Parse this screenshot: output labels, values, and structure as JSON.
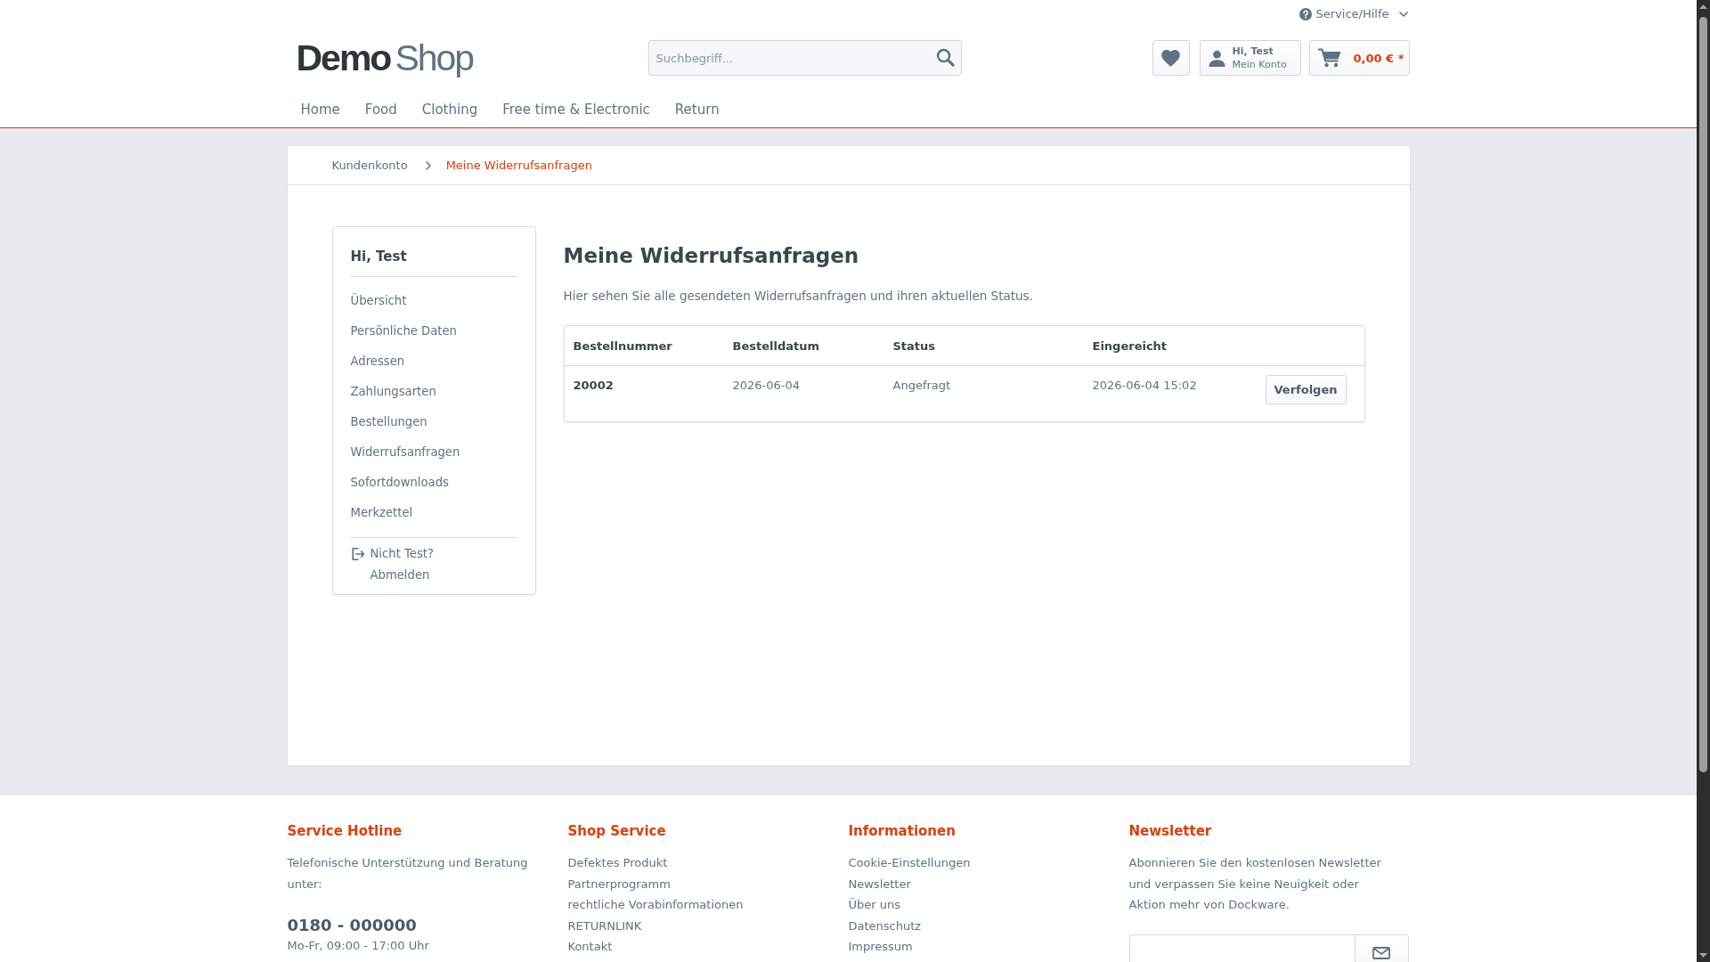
{
  "top_bar": {
    "service_menu": "Service/Hilfe"
  },
  "header": {
    "logo": "**Demo**Shop",
    "search": {
      "placeholder": "Suchbegriff..."
    },
    "account": {
      "greeting": "Hi, Test",
      "label": "Mein Konto"
    },
    "cart": {
      "total": "0,00 € *"
    }
  },
  "navigation": [
    "Home",
    "Food",
    "Clothing",
    "Free time & Electronic",
    "Return"
  ],
  "breadcrumb": [
    {
      "label": "Kundenkonto",
      "current": false
    },
    {
      "label": "Meine Widerrufsanfragen",
      "current": true
    }
  ],
  "sidebar": {
    "greeting": "Hi, Test",
    "items": [
      "Übersicht",
      "Persönliche Daten",
      "Adressen",
      "Zahlungsarten",
      "Bestellungen",
      "Widerrufsanfragen",
      "Sofortdownloads",
      "Merkzettel"
    ],
    "logout": {
      "question": "Nicht Test?",
      "label": "Abmelden"
    }
  },
  "content": {
    "title": "Meine Widerrufsanfragen",
    "description": "Hier sehen Sie alle gesendeten Widerrufsanfragen und ihren aktuellen Status.",
    "table": {
      "columns": [
        "Bestellnummer",
        "Bestelldatum",
        "Status",
        "Eingereicht"
      ],
      "rows": [
        {
          "cells": [
            "20002",
            "2026-06-04",
            "Angefragt",
            "2026-06-04 15:02"
          ],
          "action": "Verfolgen"
        }
      ]
    }
  },
  "footer": {
    "columns": [
      {
        "kind": "hotline",
        "title": "Service Hotline",
        "text": "Telefonische Unterstützung und Beratung unter:",
        "phone": "0180 - 000000",
        "hours": "Mo-Fr, 09:00 - 17:00 Uhr"
      },
      {
        "kind": "links",
        "title": "Shop Service",
        "links": [
          "Defektes Produkt",
          "Partnerprogramm",
          "rechtliche Vorabinformationen",
          "RETURNLINK",
          "Kontakt"
        ]
      },
      {
        "kind": "links",
        "title": "Informationen",
        "links": [
          "Cookie-Einstellungen",
          "Newsletter",
          "Über uns",
          "Datenschutz",
          "Impressum"
        ]
      },
      {
        "kind": "newsletter",
        "title": "Newsletter",
        "text": "Abonnieren Sie den kostenlosen Newsletter und verpassen Sie keine Neuigkeit oder Aktion mehr von Dockware."
      }
    ]
  }
}
